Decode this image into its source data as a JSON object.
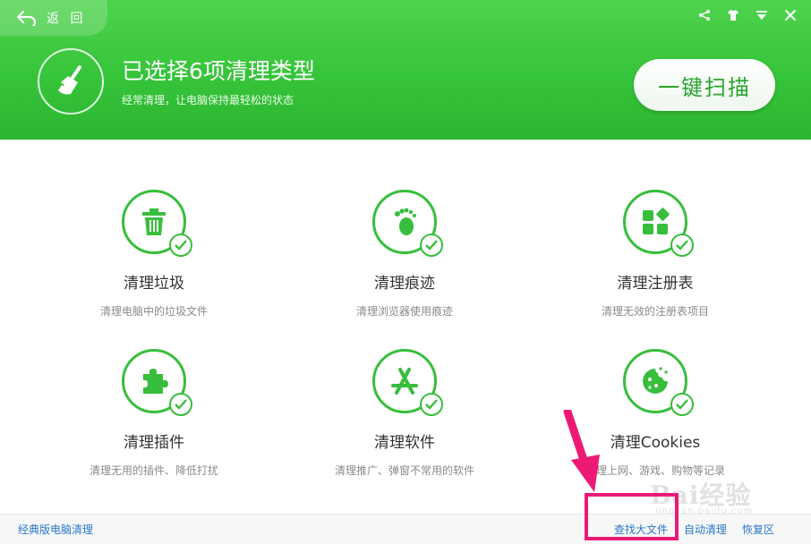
{
  "back": {
    "label": "返 回"
  },
  "window_controls": [
    "share-icon",
    "shirt-icon",
    "menu-down-icon",
    "close-icon"
  ],
  "header": {
    "title": "已选择6项清理类型",
    "subtitle": "经常清理，让电脑保持最轻松的状态",
    "scan_button": "一键扫描"
  },
  "items": [
    {
      "name": "清理垃圾",
      "desc": "清理电脑中的垃圾文件",
      "icon": "trash-icon",
      "checked": true
    },
    {
      "name": "清理痕迹",
      "desc": "清理浏览器使用痕迹",
      "icon": "footprint-icon",
      "checked": true
    },
    {
      "name": "清理注册表",
      "desc": "清理无效的注册表项目",
      "icon": "registry-icon",
      "checked": true
    },
    {
      "name": "清理插件",
      "desc": "清理无用的插件、降低打扰",
      "icon": "puzzle-icon",
      "checked": true
    },
    {
      "name": "清理软件",
      "desc": "清理推广、弹窗不常用的软件",
      "icon": "app-store-icon",
      "checked": true
    },
    {
      "name": "清理Cookies",
      "desc": "清理上网、游戏、购物等记录",
      "icon": "cookie-icon",
      "checked": true
    }
  ],
  "footer": {
    "classic": "经典版电脑清理",
    "find_big_files": "查找大文件",
    "auto_clean": "自动清理",
    "restore": "恢复区"
  },
  "watermark": {
    "text": "Bai经验",
    "sub": "jingyan.baidu.com"
  },
  "colors": {
    "accent": "#38be3c",
    "highlight": "#ec1a74",
    "link": "#2a76c6"
  }
}
